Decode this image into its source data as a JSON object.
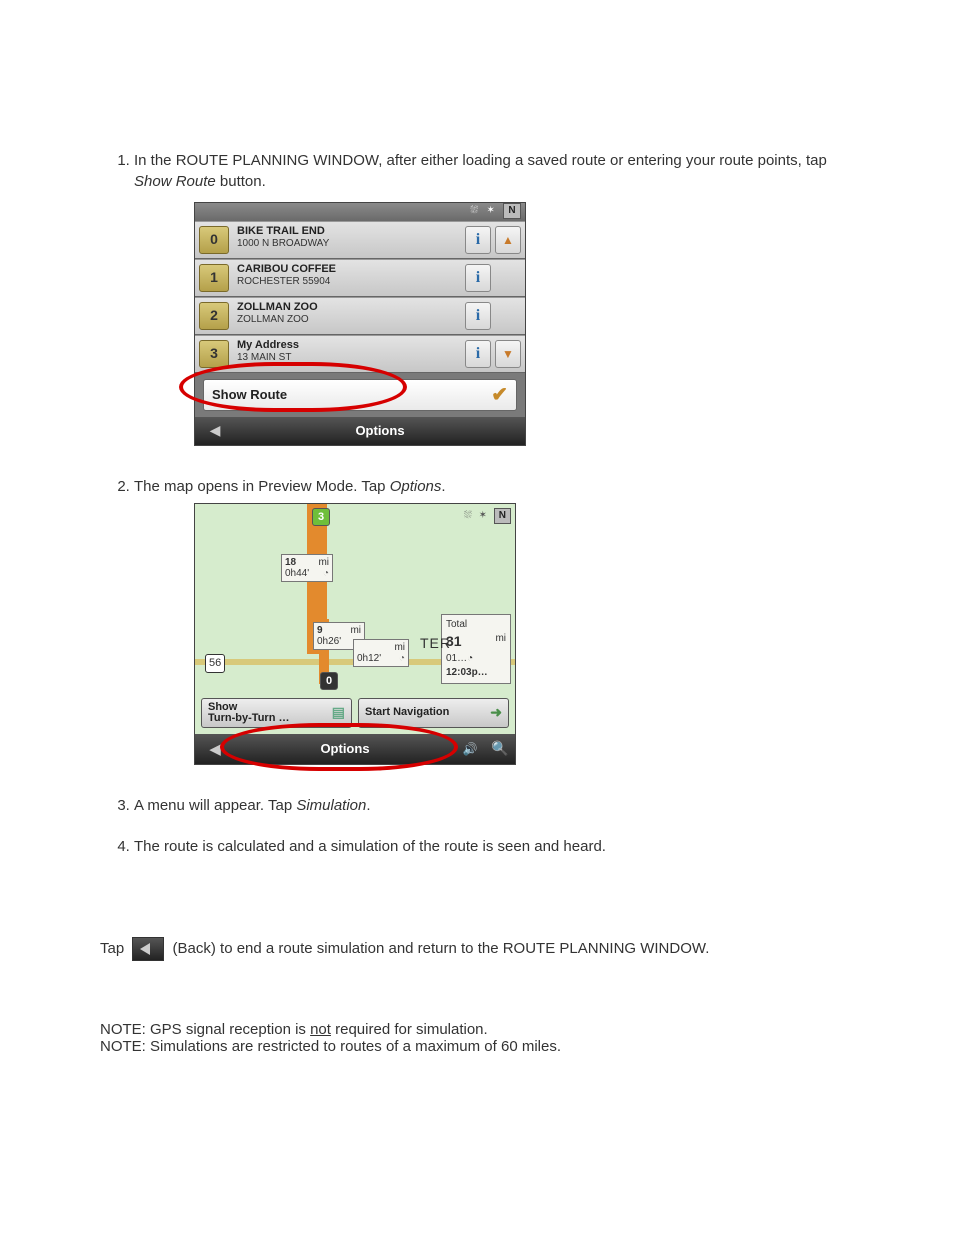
{
  "steps": {
    "s1_a": "In the ROUTE PLANNING WINDOW, after either loading a saved route or entering your route points, tap ",
    "s1_b": "Show Route",
    "s1_c": " button.",
    "s2_a": "The map opens in Preview Mode.  Tap ",
    "s2_b": "Options",
    "s2_c": ".",
    "s3_a": "A menu will appear.  Tap ",
    "s3_b": "Simulation",
    "s3_c": ".",
    "s4": "The route is calculated and a simulation of the route is seen and heard."
  },
  "shot1": {
    "top_north": "N",
    "rows": [
      {
        "num": "0",
        "title": "BIKE TRAIL END",
        "sub": "1000 N BROADWAY",
        "arrow": "▲"
      },
      {
        "num": "1",
        "title": "CARIBOU COFFEE",
        "sub": "ROCHESTER 55904",
        "arrow": ""
      },
      {
        "num": "2",
        "title": "ZOLLMAN ZOO",
        "sub": "ZOLLMAN ZOO",
        "arrow": ""
      },
      {
        "num": "3",
        "title": "My Address",
        "sub": "13 MAIN ST",
        "arrow": "▼"
      }
    ],
    "show_route": "Show Route",
    "info_glyph": "i",
    "check_glyph": "✔",
    "back_glyph": "◀",
    "options": "Options"
  },
  "shot2": {
    "top_north": "N",
    "pin0": "0",
    "pin3": "3",
    "seg1": {
      "dist": "18",
      "unit": "mi",
      "time": "0h44'"
    },
    "seg2": {
      "dist": "9",
      "unit": "mi",
      "time": "0h26'"
    },
    "seg3": {
      "unit": "mi",
      "time": "0h12'"
    },
    "total": {
      "label": "Total",
      "dist": "31",
      "unit": "mi",
      "sub": "01…",
      "eta": "12:03p…"
    },
    "route56": "56",
    "ter": "TER",
    "btn_turn": "Show\nTurn-by-Turn …",
    "btn_start": "Start Navigation",
    "back_glyph": "◀",
    "options": "Options",
    "speaker": "🔊",
    "search": "🔍"
  },
  "tapback": {
    "a": "Tap ",
    "b": " (Back) to end a route simulation and return to the ROUTE PLANNING WINDOW."
  },
  "notes": {
    "n1a": "NOTE:  GPS signal reception is ",
    "n1b": "not",
    "n1c": " required for simulation.",
    "n2": "NOTE:  Simulations are restricted to routes of a maximum of 60 miles."
  }
}
